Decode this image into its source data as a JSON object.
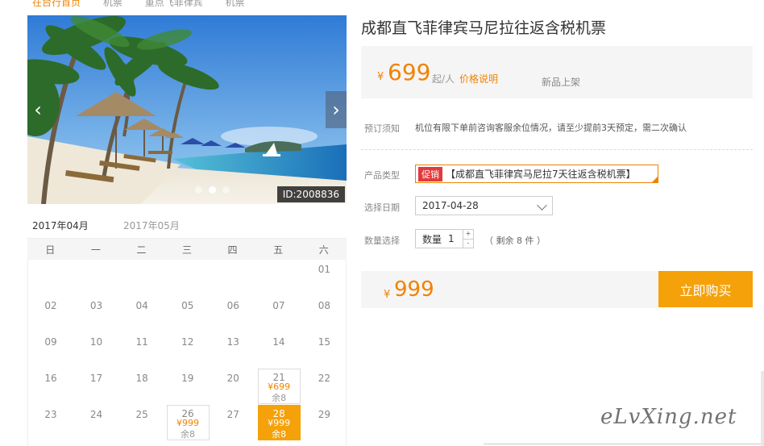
{
  "breadcrumb": [
    "在台行首页",
    "机票",
    "重点飞菲律宾",
    "机票"
  ],
  "hero": {
    "id_label": "ID:2008836",
    "prev_icon": "chevron-left-icon",
    "next_icon": "chevron-right-icon",
    "dots": 3
  },
  "calendar": {
    "tabs": [
      "2017年04月",
      "2017年05月"
    ],
    "weekdays": [
      "日",
      "一",
      "二",
      "三",
      "四",
      "五",
      "六"
    ],
    "weeks": [
      [
        "",
        "",
        "",
        "",
        "",
        "",
        "01"
      ],
      [
        "02",
        "03",
        "04",
        "05",
        "06",
        "07",
        "08"
      ],
      [
        "09",
        "10",
        "11",
        "12",
        "13",
        "14",
        "15"
      ],
      [
        "16",
        "17",
        "18",
        "19",
        "20",
        "21",
        "22"
      ],
      [
        "23",
        "24",
        "25",
        "26",
        "27",
        "28",
        "29"
      ]
    ],
    "priced_days": {
      "21": {
        "price": "¥699",
        "left": "余8"
      },
      "26": {
        "price": "¥999",
        "left": "余8"
      },
      "28": {
        "price": "¥999",
        "left": "余8",
        "selected": true
      }
    }
  },
  "product": {
    "title": "成都直飞菲律宾马尼拉往返含税机票",
    "price_yen": "¥",
    "price": "699",
    "per": "起/人",
    "price_explain": "价格说明",
    "new_tag": "新品上架",
    "notice_label": "预订须知",
    "notice_text": "机位有限下单前咨询客服余位情况，请至少提前3天预定，需二次确认",
    "type_label": "产品类型",
    "promo_badge": "促销",
    "type_value": "【成都直飞菲律宾马尼拉7天往返含税机票】",
    "date_label": "选择日期",
    "date_value": "2017-04-28",
    "qty_label": "数量选择",
    "qty_inner_label": "数量",
    "qty_value": "1",
    "qty_plus": "+",
    "qty_minus": "-",
    "remain": "（ 剩余 8 件 ）",
    "total_yen": "¥",
    "total": "999",
    "buy_label": "立即购买"
  },
  "watermark": "eLvXing.net",
  "colors": {
    "accent": "#f08300",
    "button": "#f5a10a",
    "promo": "#e4393c"
  }
}
